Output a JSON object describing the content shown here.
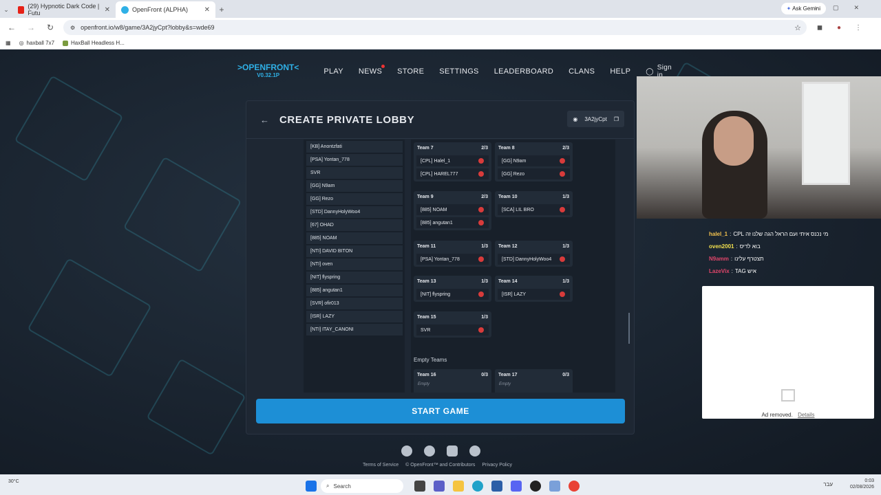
{
  "browser": {
    "tabs": [
      {
        "label": "(29) Hypnotic Dark Code | Futu",
        "active": false
      },
      {
        "label": "OpenFront (ALPHA)",
        "active": true
      }
    ],
    "ask_gemini": "Ask Gemini",
    "url": "openfront.io/w8/game/3A2jyCpt?lobby&s=wde69",
    "bookmarks": [
      "haxball 7x7",
      "HaxBall Headless H..."
    ]
  },
  "site": {
    "logo": ">OPENFRONT<",
    "version": "V0.32.1P",
    "nav": [
      "PLAY",
      "NEWS",
      "STORE",
      "SETTINGS",
      "LEADERBOARD",
      "CLANS",
      "HELP"
    ],
    "signin": "Sign in"
  },
  "lobby": {
    "title": "CREATE PRIVATE LOBBY",
    "lobby_id": "3A2jyCpt",
    "players": [
      "[KB] Anontzfati",
      "[PSA] Yontan_778",
      "SVR",
      "[GG] N9am",
      "[GG] Rezo",
      "[STD] DannyHolyWoo4",
      "[67] OHAD",
      "[885] NOAM",
      "[NTI] DAVID BITON",
      "[NTI] oven",
      "[NIT] flyspring",
      "[885] angutan1",
      "[SVR] ofir013",
      "[ISR] LAZY",
      "[NTI] ITAY_CANONI"
    ],
    "teams": [
      {
        "name": "Team 7",
        "count": "2/3",
        "members": [
          "[CPL] Halel_1",
          "[CPL] HAREL777"
        ]
      },
      {
        "name": "Team 8",
        "count": "2/3",
        "members": [
          "[GG] N9am",
          "[GG] Rezo"
        ]
      },
      {
        "name": "Team 9",
        "count": "2/3",
        "members": [
          "[885] NOAM",
          "[885] angutan1"
        ]
      },
      {
        "name": "Team 10",
        "count": "1/3",
        "members": [
          "[SCA] LIL BRO"
        ]
      },
      {
        "name": "Team 11",
        "count": "1/3",
        "members": [
          "[PSA] Yontan_778"
        ]
      },
      {
        "name": "Team 12",
        "count": "1/3",
        "members": [
          "[STD] DannyHolyWoo4"
        ]
      },
      {
        "name": "Team 13",
        "count": "1/3",
        "members": [
          "[NIT] flyspring"
        ]
      },
      {
        "name": "Team 14",
        "count": "1/3",
        "members": [
          "[ISR] LAZY"
        ]
      },
      {
        "name": "Team 15",
        "count": "1/3",
        "members": [
          "SVR"
        ]
      }
    ],
    "empty_teams_label": "Empty Teams",
    "empty_teams": [
      {
        "name": "Team 16",
        "count": "0/3",
        "label": "Empty"
      },
      {
        "name": "Team 17",
        "count": "0/3",
        "label": "Empty"
      }
    ],
    "start_button": "START GAME"
  },
  "footer": {
    "terms": "Terms of Service",
    "copyright": "© OpenFront™ and Contributors",
    "privacy": "Privacy Policy"
  },
  "chat": {
    "messages": [
      {
        "name": "halel_1",
        "color": "#f2c14e",
        "text": "מי נכנס איתי ועם הראל הגה שלנו זה CPL"
      },
      {
        "name": "oven2001",
        "color": "#f2e04e",
        "text": "בוא לדיס"
      },
      {
        "name": "N9amm",
        "color": "#e0456a",
        "text": "תצטרף עלינו"
      },
      {
        "name": "LazeVix",
        "color": "#e0456a",
        "text": "איש TAG"
      }
    ],
    "ad_removed": "Ad removed.",
    "details": "Details"
  },
  "taskbar": {
    "search": "Search",
    "lang": "עבר",
    "time": "0:03",
    "date": "02/08/2026",
    "weather": "30°C"
  }
}
